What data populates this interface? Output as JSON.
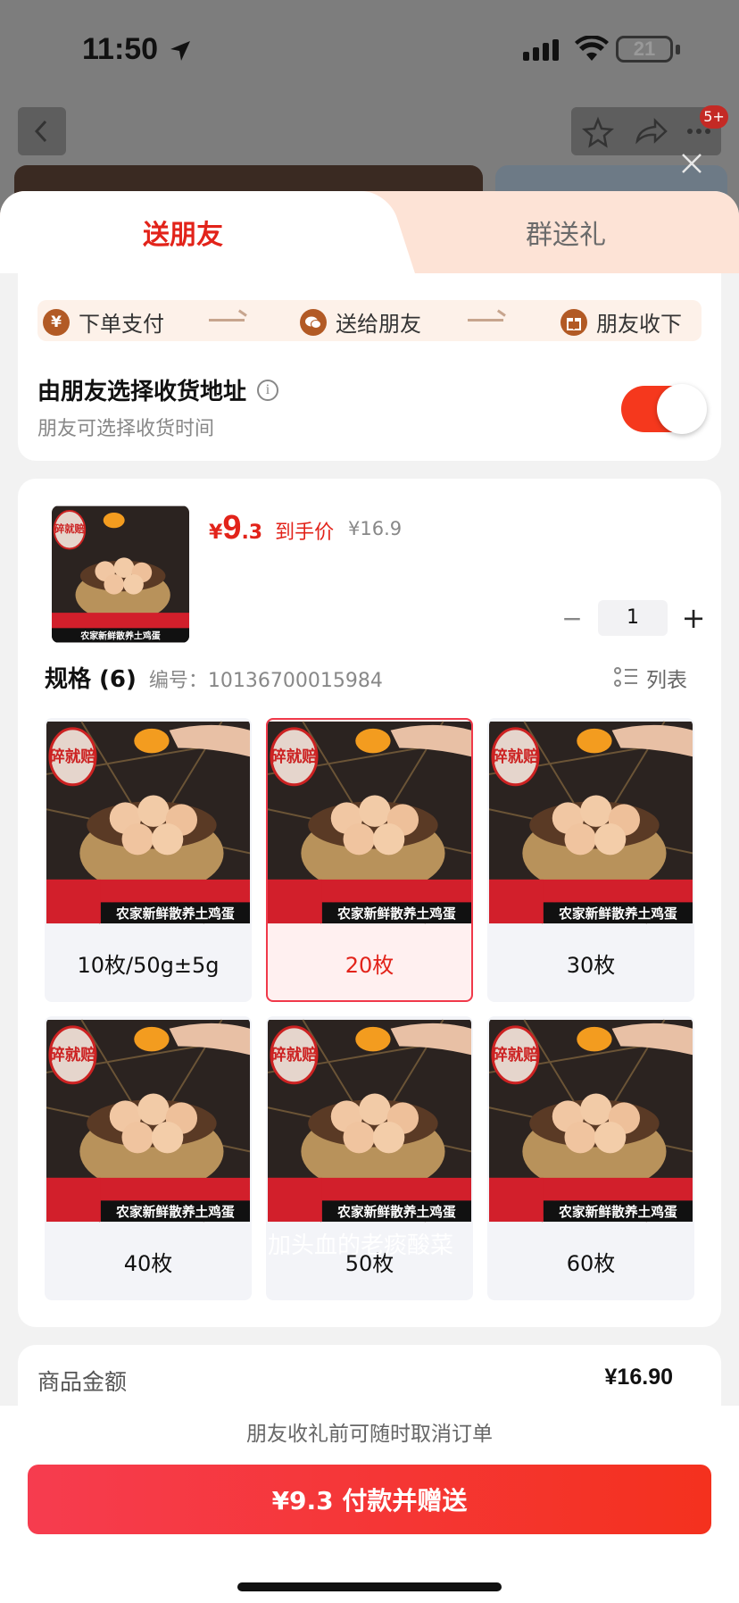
{
  "status_bar": {
    "time": "11:50",
    "battery": "21"
  },
  "background": {
    "badge": "5+"
  },
  "tabs": {
    "active": "送朋友",
    "other": "群送礼"
  },
  "flow": {
    "step1": "下单支付",
    "step2": "送给朋友",
    "step3": "朋友收下",
    "step1_icon": "¥"
  },
  "address": {
    "title": "由朋友选择收货地址",
    "subtitle": "朋友可选择收货时间",
    "toggle_on": true
  },
  "product": {
    "price_symbol": "¥",
    "price_int": "9",
    "price_dec": ".3",
    "price_tag": "到手价",
    "original_price": "¥16.9",
    "quantity": "1",
    "minus": "−",
    "plus": "+",
    "thumb_badge": "碎就赔",
    "thumb_caption": "农家新鲜散养土鸡蛋"
  },
  "spec": {
    "title": "规格 (6)",
    "number": "编号：10136700015984",
    "list_label": "列表",
    "overlay_text": "加头血的老痰酸菜",
    "items": [
      {
        "label": "10枚/50g±5g",
        "selected": false
      },
      {
        "label": "20枚",
        "selected": true
      },
      {
        "label": "30枚",
        "selected": false
      },
      {
        "label": "40枚",
        "selected": false
      },
      {
        "label": "50枚",
        "selected": false
      },
      {
        "label": "60枚",
        "selected": false
      }
    ]
  },
  "summary": {
    "label": "商品金额",
    "value": "¥16.90"
  },
  "footer": {
    "note": "朋友收礼前可随时取消订单",
    "pay_button": "¥9.3 付款并赠送"
  }
}
